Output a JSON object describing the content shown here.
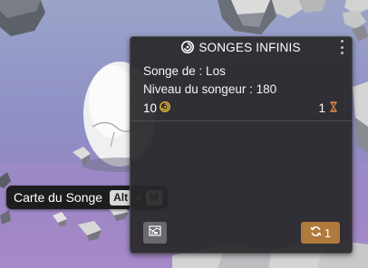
{
  "panel": {
    "title": "SONGES INFINIS",
    "title_icon": "spiral-icon",
    "songe_line": "Songe de : Los",
    "level_line": "Niveau du songeur : 180",
    "currency_value": "10",
    "currency_icon": "spiral-coin-icon",
    "timer_value": "1",
    "timer_icon": "hourglass-icon",
    "refresh_button_value": "1",
    "refresh_icon": "refresh-icon",
    "map_icon": "map-flag-icon",
    "menu_icon": "kebab-menu-icon"
  },
  "tooltip": {
    "label": "Carte du Songe",
    "key1": "Alt",
    "plus": "+",
    "key2": "M"
  },
  "colors": {
    "panel_bg": "#28282a",
    "accent_gold": "#e0b030",
    "hourglass_orange": "#d7874a",
    "refresh_button": "#b07a3d",
    "map_button": "#6a6a6e"
  }
}
